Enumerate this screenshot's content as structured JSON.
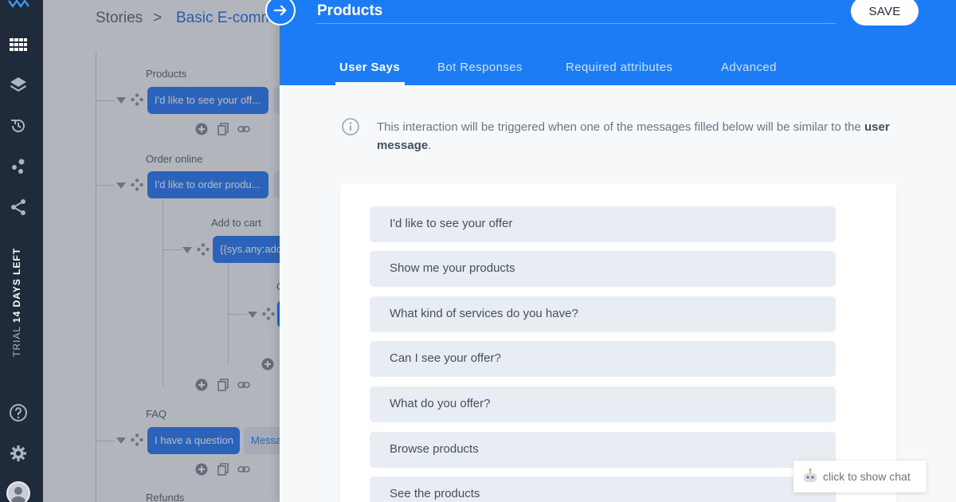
{
  "sidebar": {
    "trial_prefix": "TRIAL",
    "trial_days": "14 DAYS LEFT",
    "icons": [
      "logo-icon",
      "grid-icon",
      "layers-icon",
      "history-icon",
      "integrations-icon",
      "share-icon",
      "help-icon",
      "gear-icon",
      "avatar"
    ]
  },
  "breadcrumb": {
    "root": "Stories",
    "separator": ">",
    "current": "Basic E-comm"
  },
  "canvas": {
    "interactions": [
      {
        "label": "Products",
        "node": "I'd like to see your off..."
      },
      {
        "label": "Order online",
        "node": "I'd like to order produ..."
      },
      {
        "label": "Add to cart",
        "node": "{{sys.any:add"
      },
      {
        "label": "FAQ",
        "node": "I have a question",
        "response": "Messa"
      },
      {
        "label": "Refunds"
      }
    ],
    "partial_label": "C"
  },
  "panel": {
    "title": "Products",
    "save_label": "SAVE",
    "tabs": [
      {
        "label": "User Says",
        "active": true
      },
      {
        "label": "Bot Responses",
        "active": false
      },
      {
        "label": "Required attributes",
        "active": false
      },
      {
        "label": "Advanced",
        "active": false
      }
    ],
    "info": {
      "text_before": "This interaction will be triggered when one of the messages filled below will be similar to the ",
      "text_bold": "user message",
      "text_after": "."
    },
    "user_says": [
      "I'd like to see your offer",
      "Show me your products",
      "What kind of services do you have?",
      "Can I see your offer?",
      "What do you offer?",
      "Browse products",
      "See the products"
    ]
  },
  "chat_widget": {
    "label": "click to show chat"
  },
  "colors": {
    "accent": "#1c7cf6",
    "rail": "#1f2a3a",
    "node": "#2f7cf6",
    "utterance_bg": "#e8edf3"
  }
}
